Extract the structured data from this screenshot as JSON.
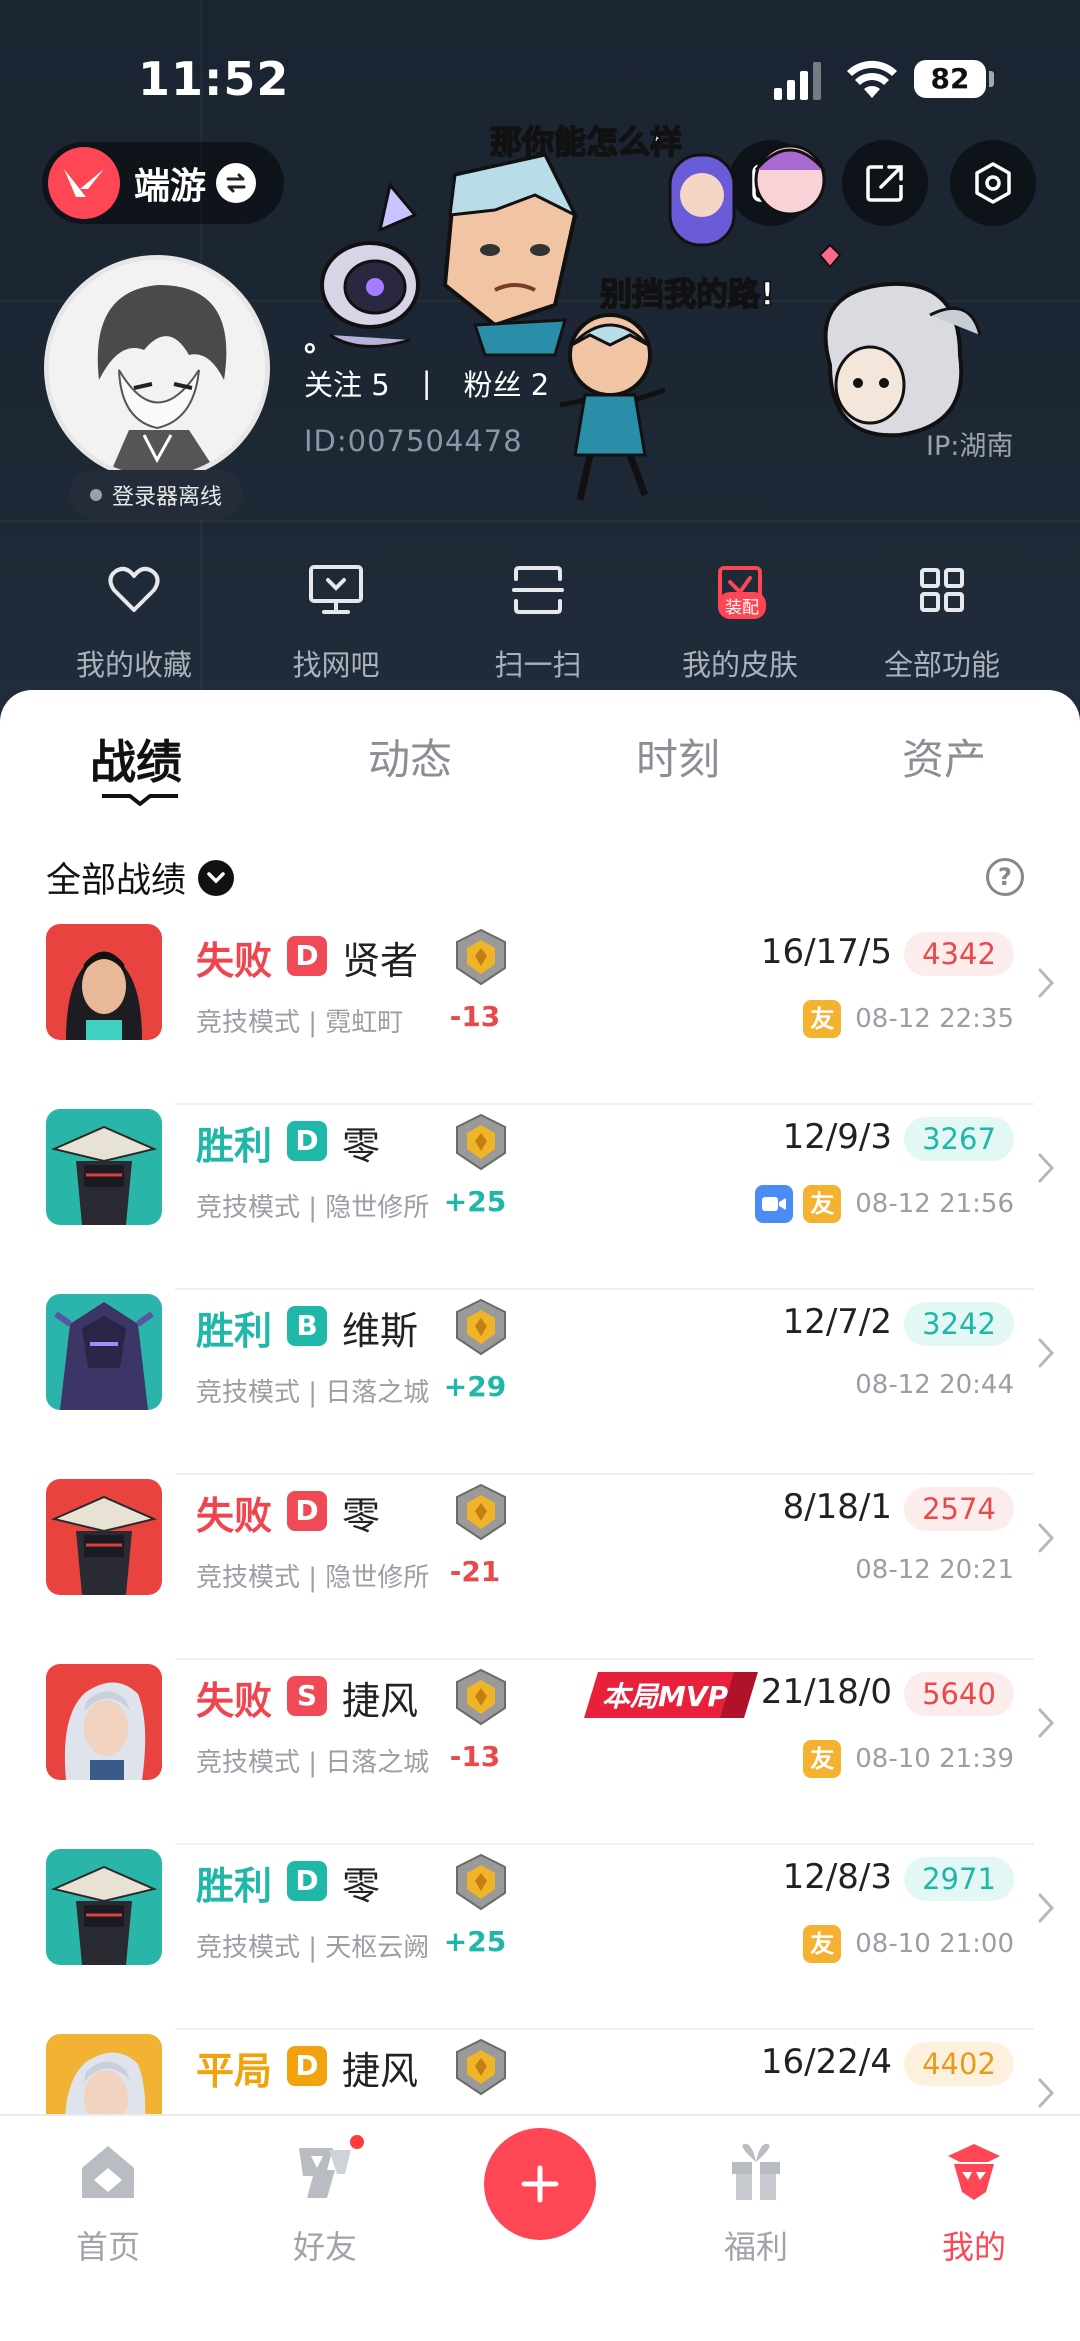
{
  "status_bar": {
    "time": "11:52",
    "battery": "82"
  },
  "header": {
    "game_name": "端游",
    "sticker_text_1": "那你能怎么样",
    "sticker_text_2": "别挡我的路!"
  },
  "profile": {
    "nickname": "。",
    "login_status": "登录器离线",
    "follow_label": "关注",
    "follow_count": "5",
    "fans_label": "粉丝",
    "fans_count": "2",
    "user_id": "ID:007504478",
    "ip": "IP:湖南"
  },
  "quick_actions": [
    {
      "label": "我的收藏",
      "icon": "heart-icon"
    },
    {
      "label": "找网吧",
      "icon": "monitor-icon"
    },
    {
      "label": "扫一扫",
      "icon": "scan-icon"
    },
    {
      "label": "我的皮肤",
      "icon": "skin-icon",
      "badge": "装配"
    },
    {
      "label": "全部功能",
      "icon": "grid-icon"
    }
  ],
  "tabs": [
    "战绩",
    "动态",
    "时刻",
    "资产"
  ],
  "section": {
    "title": "全部战绩"
  },
  "matches": [
    {
      "result": "失败",
      "rank": "D",
      "agent": "贤者",
      "meta": "竞技模式 | 霓虹町",
      "rr": "-13",
      "kda": "16/17/5",
      "score": "4342",
      "time": "08-12 22:35",
      "friend": "友"
    },
    {
      "result": "胜利",
      "rank": "D",
      "agent": "零",
      "meta": "竞技模式 | 隐世修所",
      "rr": "+25",
      "kda": "12/9/3",
      "score": "3267",
      "time": "08-12 21:56",
      "friend": "友"
    },
    {
      "result": "胜利",
      "rank": "B",
      "agent": "维斯",
      "meta": "竞技模式 | 日落之城",
      "rr": "+29",
      "kda": "12/7/2",
      "score": "3242",
      "time": "08-12 20:44"
    },
    {
      "result": "失败",
      "rank": "D",
      "agent": "零",
      "meta": "竞技模式 | 隐世修所",
      "rr": "-21",
      "kda": "8/18/1",
      "score": "2574",
      "time": "08-12 20:21"
    },
    {
      "result": "失败",
      "rank": "S",
      "agent": "捷风",
      "meta": "竞技模式 | 日落之城",
      "rr": "-13",
      "kda": "21/18/0",
      "score": "5640",
      "time": "08-10 21:39",
      "friend": "友",
      "mvp": "本局MVP"
    },
    {
      "result": "胜利",
      "rank": "D",
      "agent": "零",
      "meta": "竞技模式 | 天枢云阙",
      "rr": "+25",
      "kda": "12/8/3",
      "score": "2971",
      "time": "08-10 21:00",
      "friend": "友"
    },
    {
      "result": "平局",
      "rank": "D",
      "agent": "捷风",
      "kda": "16/22/4",
      "score": "4402"
    }
  ],
  "bottom_nav": [
    {
      "label": "首页",
      "icon": "home-icon"
    },
    {
      "label": "好友",
      "icon": "friends-icon"
    },
    {
      "label": "福利",
      "icon": "gift-icon"
    },
    {
      "label": "我的",
      "icon": "profile-icon"
    }
  ],
  "colors": {
    "accent": "#ff4655",
    "win": "#1fb7a8",
    "loss": "#f0454f",
    "draw": "#f2a20b"
  }
}
